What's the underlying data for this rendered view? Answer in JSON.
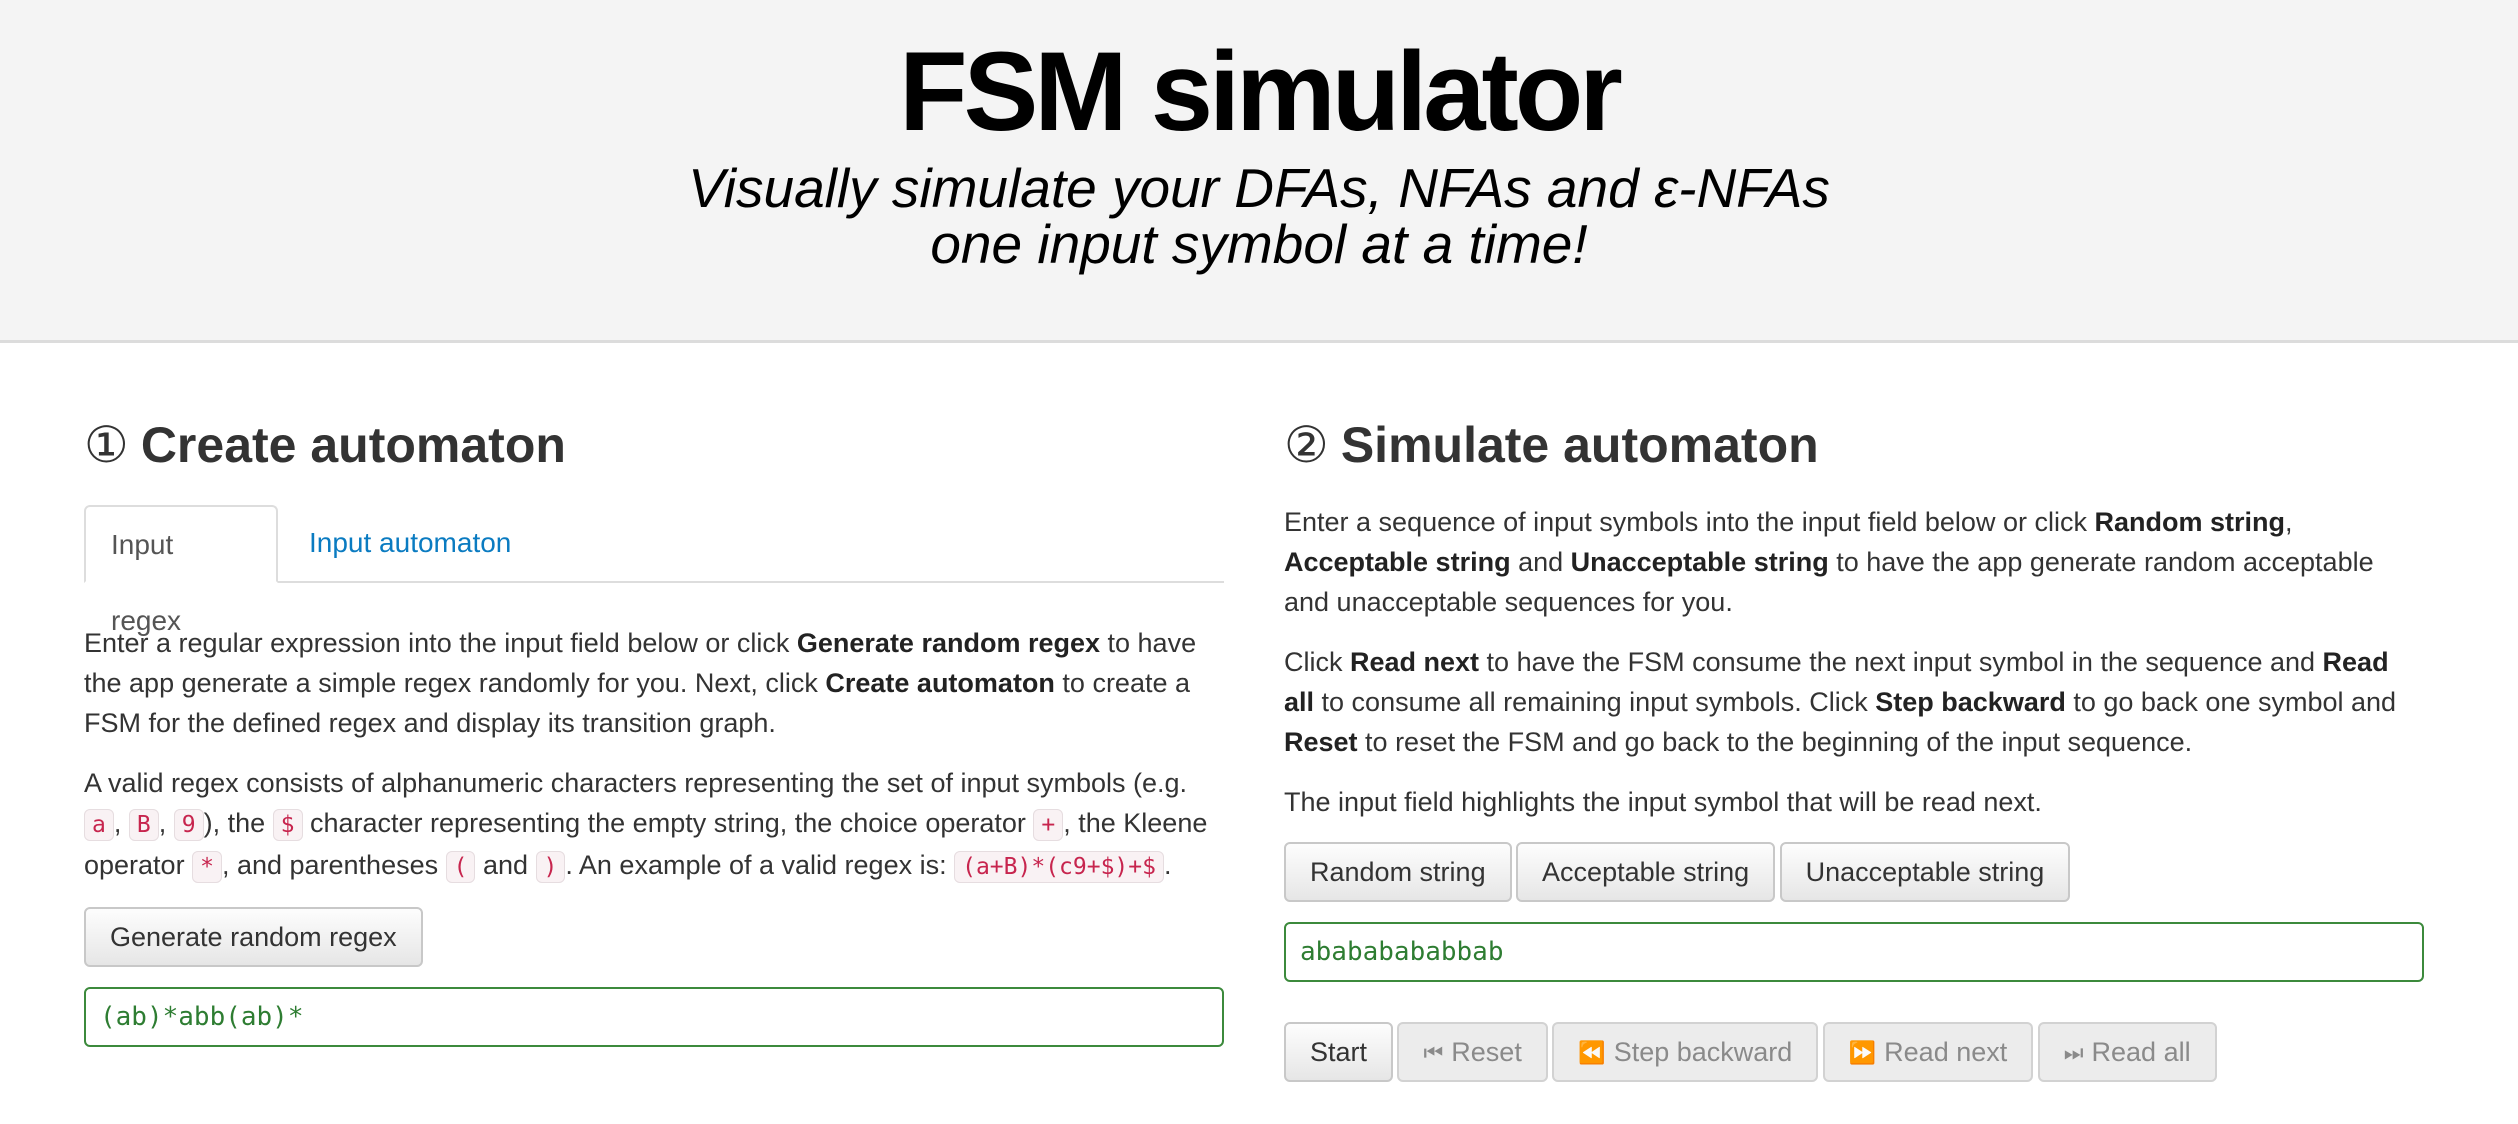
{
  "header": {
    "title": "FSM simulator",
    "subtitle_line1": "Visually simulate your DFAs, NFAs and ε-NFAs",
    "subtitle_line2": "one input symbol at a time!"
  },
  "create": {
    "number": "①",
    "title": "Create automaton",
    "tabs": [
      {
        "label": "Input regex",
        "active": true
      },
      {
        "label": "Input automaton",
        "active": false
      }
    ],
    "p1": {
      "t1": "Enter a regular expression into the input field below or click ",
      "b1": "Generate random regex",
      "t2": " to have the app generate a simple regex randomly for you. Next, click ",
      "b2": "Create automaton",
      "t3": " to create a FSM for the defined regex and display its transition graph."
    },
    "p2": {
      "t1": "A valid regex consists of alphanumeric characters representing the set of input symbols (e.g. ",
      "c1": "a",
      "s1": ", ",
      "c2": "B",
      "s2": ", ",
      "c3": "9",
      "t2": "), the ",
      "c4": "$",
      "t3": " character representing the empty string, the choice operator ",
      "c5": "+",
      "t4": ", the Kleene operator ",
      "c6": "*",
      "t5": ", and parentheses ",
      "c7": "(",
      "t6": " and ",
      "c8": ")",
      "t7": ". An example of a valid regex is: ",
      "c9": "(a+B)*(c9+$)+$",
      "t8": "."
    },
    "generate_button": "Generate random regex",
    "regex_value": "(ab)*abb(ab)*"
  },
  "simulate": {
    "number": "②",
    "title": "Simulate automaton",
    "p1": {
      "t1": "Enter a sequence of input symbols into the input field below or click ",
      "b1": "Random string",
      "t2": ", ",
      "b2": "Acceptable string",
      "t3": " and ",
      "b3": "Unacceptable string",
      "t4": " to have the app generate random acceptable and unacceptable sequences for you."
    },
    "p2": {
      "t1": "Click ",
      "b1": "Read next",
      "t2": " to have the FSM consume the next input symbol in the sequence and ",
      "b2": "Read all",
      "t3": " to consume all remaining input symbols. Click ",
      "b3": "Step backward",
      "t4": " to go back one symbol and ",
      "b4": "Reset",
      "t5": " to reset the FSM and go back to the beginning of the input sequence."
    },
    "p3": "The input field highlights the input symbol that will be read next.",
    "string_buttons": [
      "Random string",
      "Acceptable string",
      "Unacceptable string"
    ],
    "input_value": "abababababbab",
    "controls": {
      "start": "Start",
      "reset": "Reset",
      "step_backward": "Step backward",
      "read_next": "Read next",
      "read_all": "Read all"
    }
  }
}
